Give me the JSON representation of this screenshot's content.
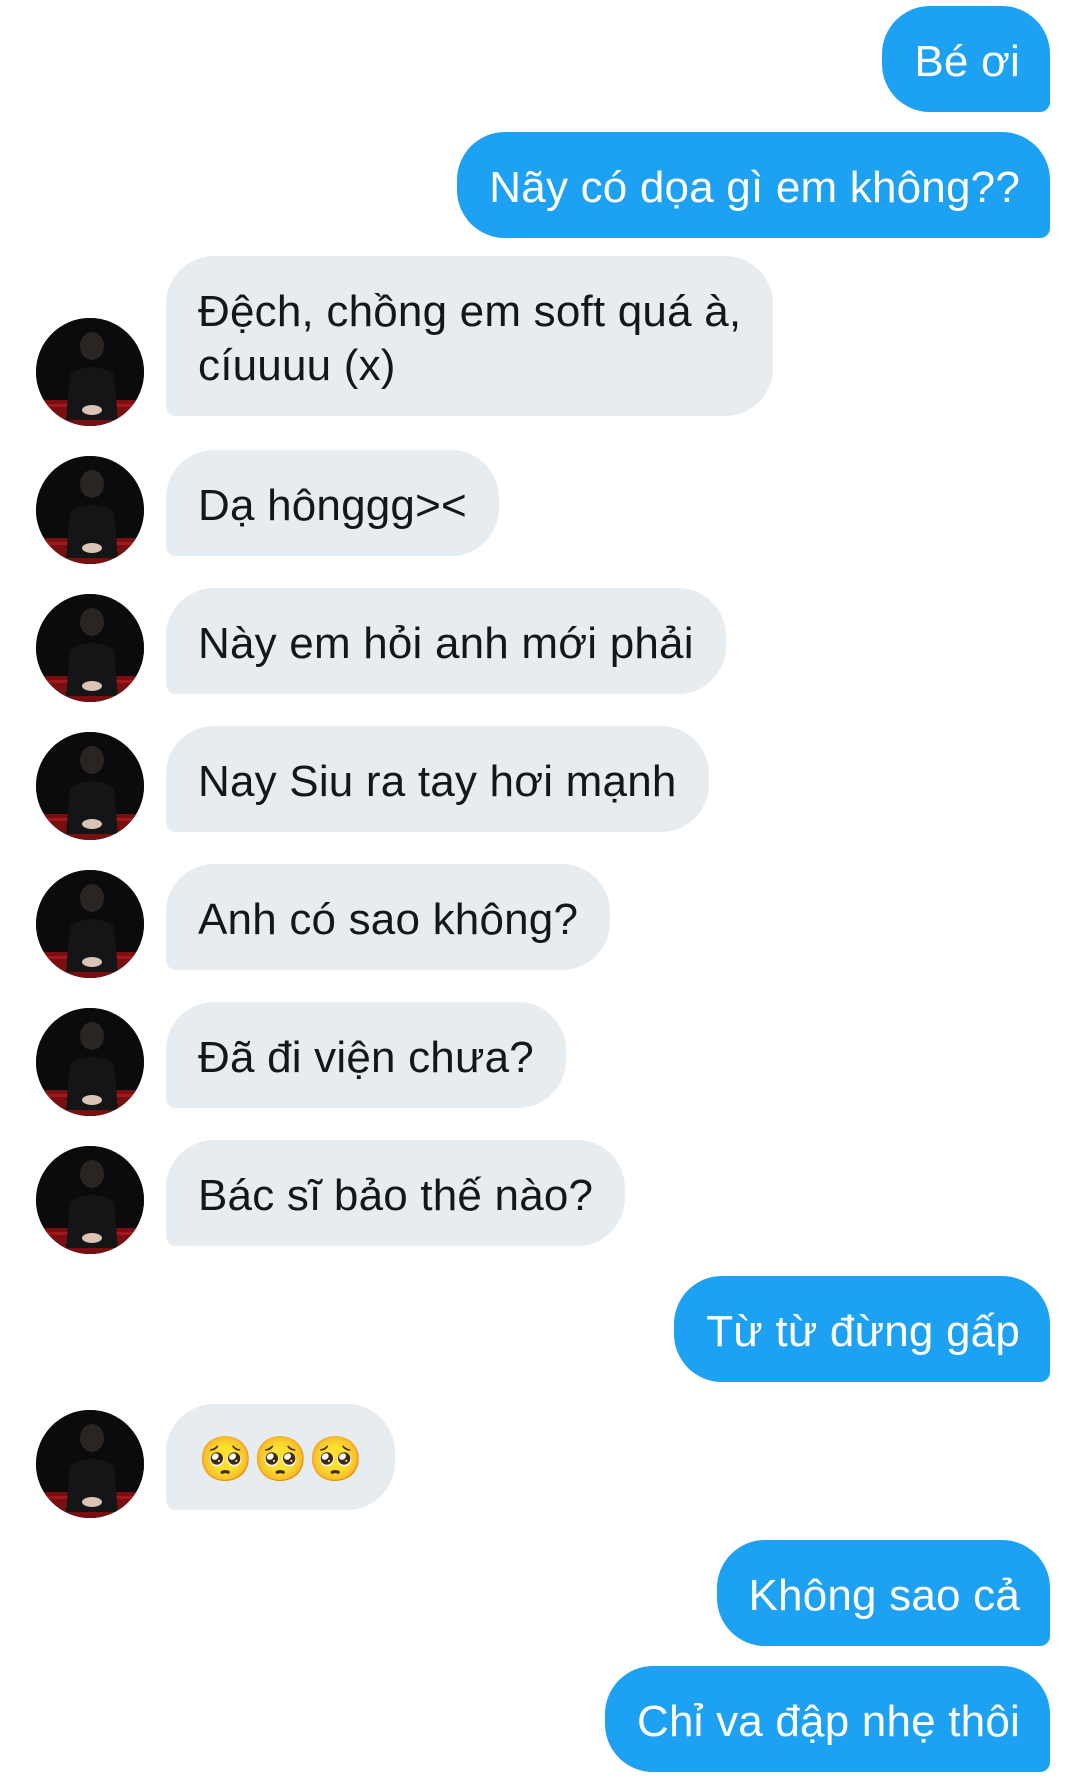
{
  "messages": [
    {
      "side": "sent",
      "text": "Bé ơi"
    },
    {
      "side": "sent",
      "text": "Nãy có dọa gì em không??"
    },
    {
      "side": "recv",
      "text": "Đệch, chồng em soft quá à,\ncíuuuu (x)",
      "avatar": "profile-photo-icon"
    },
    {
      "side": "recv",
      "text": "Dạ hônggg><",
      "avatar": "profile-photo-icon"
    },
    {
      "side": "recv",
      "text": "Này em hỏi anh mới phải",
      "avatar": "profile-photo-icon"
    },
    {
      "side": "recv",
      "text": "Nay Siu ra tay hơi mạnh",
      "avatar": "profile-photo-icon"
    },
    {
      "side": "recv",
      "text": "Anh có sao không?",
      "avatar": "profile-photo-icon"
    },
    {
      "side": "recv",
      "text": "Đã đi viện chưa?",
      "avatar": "profile-photo-icon"
    },
    {
      "side": "recv",
      "text": "Bác sĩ bảo thế nào?",
      "avatar": "profile-photo-icon"
    },
    {
      "side": "sent",
      "text": "Từ từ đừng gấp"
    },
    {
      "side": "recv",
      "text": "🥺🥺🥺",
      "avatar": "profile-photo-icon"
    },
    {
      "side": "sent",
      "text": "Không sao cả"
    },
    {
      "side": "sent",
      "text": "Chỉ va đập nhẹ thôi"
    }
  ],
  "colors": {
    "sent_bubble": "#1da1f2",
    "sent_text": "#ffffff",
    "received_bubble": "#e6ecf0",
    "received_text": "#14171a",
    "background": "#ffffff"
  }
}
